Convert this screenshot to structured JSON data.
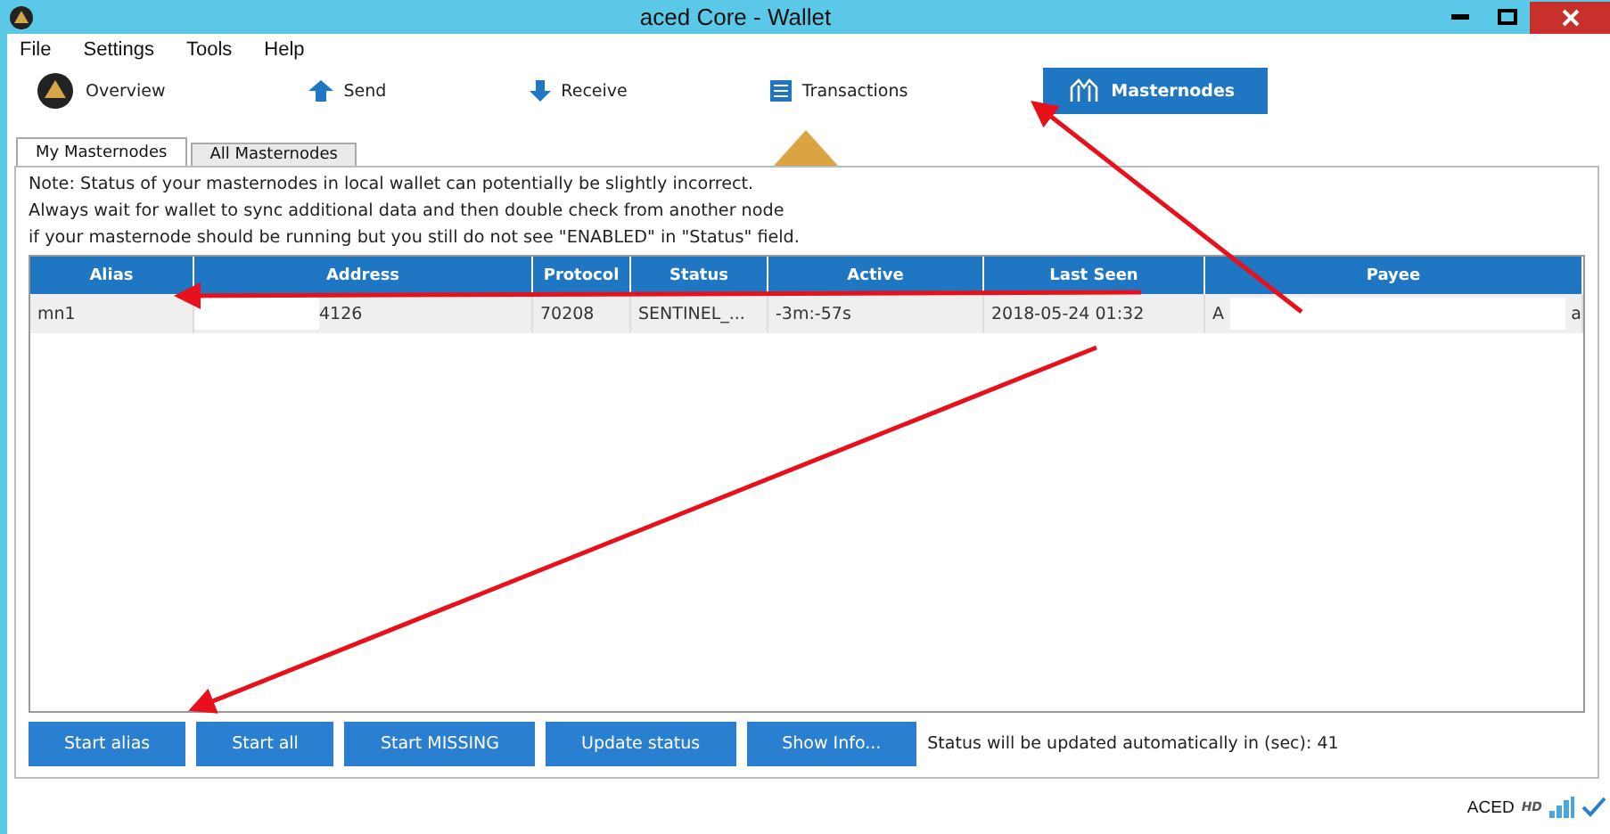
{
  "window": {
    "title": "aced Core - Wallet"
  },
  "menu": [
    "File",
    "Settings",
    "Tools",
    "Help"
  ],
  "toolbar": [
    {
      "label": "Overview",
      "kind": "logo",
      "selected": false
    },
    {
      "label": "Send",
      "kind": "up",
      "selected": false
    },
    {
      "label": "Receive",
      "kind": "down",
      "selected": false
    },
    {
      "label": "Transactions",
      "kind": "list",
      "selected": false
    },
    {
      "label": "Masternodes",
      "kind": "node",
      "selected": true
    }
  ],
  "tabs": [
    {
      "label": "My Masternodes",
      "selected": true
    },
    {
      "label": "All Masternodes",
      "selected": false
    }
  ],
  "note": [
    "Note: Status of your masternodes in local wallet can potentially be slightly incorrect.",
    "Always wait for wallet to sync additional data and then double check from another node",
    "if your masternode should be running but you still do not see \"ENABLED\" in \"Status\" field."
  ],
  "table": {
    "columns": [
      "Alias",
      "Address",
      "Protocol",
      "Status",
      "Active",
      "Last Seen",
      "Payee"
    ],
    "rows": [
      {
        "alias": "mn1",
        "address": "4126",
        "protocol": "70208",
        "status": "SENTINEL_...",
        "active": "-3m:-57s",
        "last_seen": "2018-05-24 01:32",
        "payee_start": "A",
        "payee_end": "a"
      }
    ]
  },
  "buttons": [
    "Start alias",
    "Start all",
    "Start MISSING",
    "Update status",
    "Show Info..."
  ],
  "update_text": "Status will be updated automatically in (sec): 41",
  "status_bar": {
    "unit": "ACED",
    "badge": "HD"
  }
}
